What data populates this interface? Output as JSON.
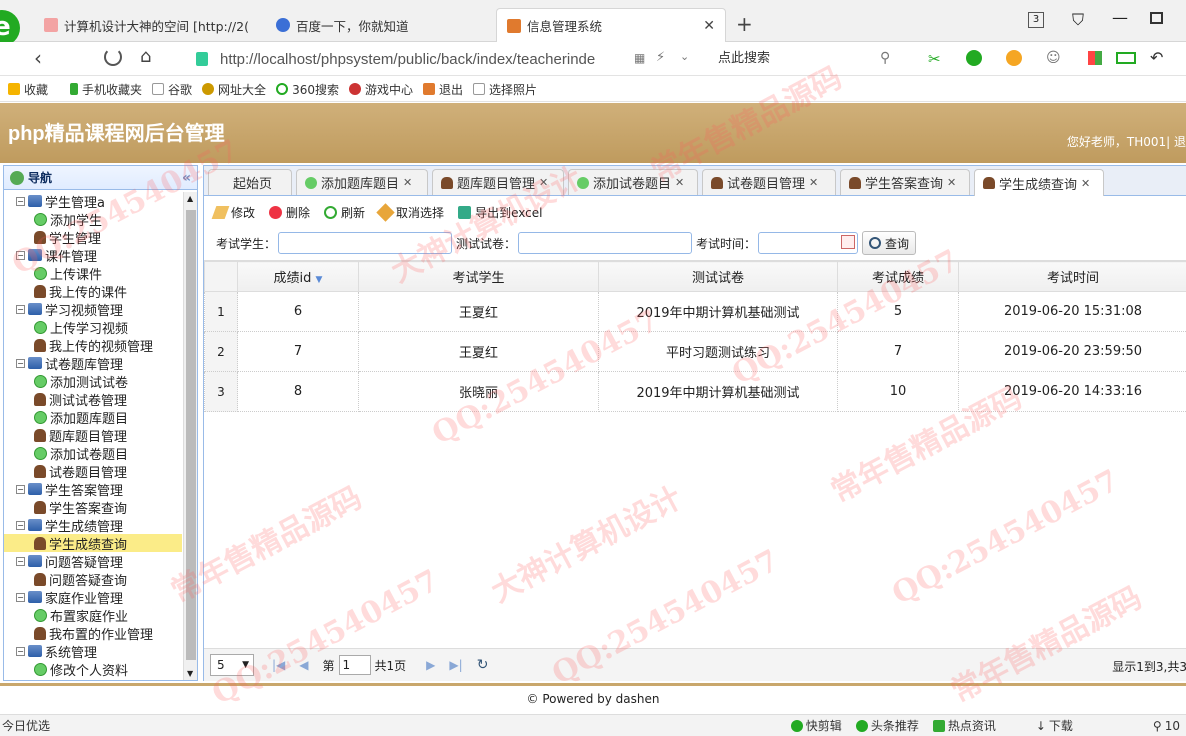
{
  "browser": {
    "tabs": [
      {
        "label": "计算机设计大神的空间 [http://2(",
        "active": false
      },
      {
        "label": "百度一下，你就知道",
        "active": false
      },
      {
        "label": "信息管理系统",
        "active": true
      }
    ],
    "tab_count": "3",
    "url": "http://localhost/phpsystem/public/back/index/teacherinde",
    "search_placeholder": "点此搜索",
    "bookmarks": [
      "收藏",
      "手机收藏夹",
      "谷歌",
      "网址大全",
      "360搜索",
      "游戏中心",
      "退出",
      "选择照片"
    ]
  },
  "app": {
    "title": "php精品课程网后台管理",
    "welcome": "您好老师，TH001| 退"
  },
  "nav": {
    "title": "导航",
    "tree": [
      {
        "label": "学生管理a",
        "level": 0,
        "icon": "folder"
      },
      {
        "label": "添加学生",
        "level": 1,
        "icon": "add"
      },
      {
        "label": "学生管理",
        "level": 1,
        "icon": "user"
      },
      {
        "label": "课件管理",
        "level": 0,
        "icon": "folder"
      },
      {
        "label": "上传课件",
        "level": 1,
        "icon": "add"
      },
      {
        "label": "我上传的课件",
        "level": 1,
        "icon": "user"
      },
      {
        "label": "学习视频管理",
        "level": 0,
        "icon": "folder"
      },
      {
        "label": "上传学习视频",
        "level": 1,
        "icon": "add"
      },
      {
        "label": "我上传的视频管理",
        "level": 1,
        "icon": "user"
      },
      {
        "label": "试卷题库管理",
        "level": 0,
        "icon": "folder"
      },
      {
        "label": "添加测试试卷",
        "level": 1,
        "icon": "add"
      },
      {
        "label": "测试试卷管理",
        "level": 1,
        "icon": "user"
      },
      {
        "label": "添加题库题目",
        "level": 1,
        "icon": "add"
      },
      {
        "label": "题库题目管理",
        "level": 1,
        "icon": "user"
      },
      {
        "label": "添加试卷题目",
        "level": 1,
        "icon": "add"
      },
      {
        "label": "试卷题目管理",
        "level": 1,
        "icon": "user"
      },
      {
        "label": "学生答案管理",
        "level": 0,
        "icon": "folder"
      },
      {
        "label": "学生答案查询",
        "level": 1,
        "icon": "user"
      },
      {
        "label": "学生成绩管理",
        "level": 0,
        "icon": "folder"
      },
      {
        "label": "学生成绩查询",
        "level": 1,
        "icon": "user",
        "selected": true
      },
      {
        "label": "问题答疑管理",
        "level": 0,
        "icon": "folder"
      },
      {
        "label": "问题答疑查询",
        "level": 1,
        "icon": "user"
      },
      {
        "label": "家庭作业管理",
        "level": 0,
        "icon": "folder"
      },
      {
        "label": "布置家庭作业",
        "level": 1,
        "icon": "add"
      },
      {
        "label": "我布置的作业管理",
        "level": 1,
        "icon": "user"
      },
      {
        "label": "系统管理",
        "level": 0,
        "icon": "folder"
      },
      {
        "label": "修改个人资料",
        "level": 1,
        "icon": "edit"
      }
    ]
  },
  "panel_tabs": [
    {
      "label": "起始页",
      "closable": false
    },
    {
      "label": "添加题库题目",
      "closable": true
    },
    {
      "label": "题库题目管理",
      "closable": true
    },
    {
      "label": "添加试卷题目",
      "closable": true
    },
    {
      "label": "试卷题目管理",
      "closable": true
    },
    {
      "label": "学生答案查询",
      "closable": true
    },
    {
      "label": "学生成绩查询",
      "closable": true,
      "active": true
    }
  ],
  "toolbar": {
    "edit": "修改",
    "delete": "删除",
    "refresh": "刷新",
    "deselect": "取消选择",
    "export": "导出到excel"
  },
  "filter": {
    "student_label": "考试学生：",
    "paper_label": "测试试卷：",
    "time_label": "考试时间：",
    "query": "查询"
  },
  "grid": {
    "columns": [
      "成绩id",
      "考试学生",
      "测试试卷",
      "考试成绩",
      "考试时间"
    ],
    "rows": [
      {
        "n": "1",
        "id": "6",
        "student": "王夏红",
        "paper": "2019年中期计算机基础测试",
        "score": "5",
        "time": "2019-06-20 15:31:08"
      },
      {
        "n": "2",
        "id": "7",
        "student": "王夏红",
        "paper": "平时习题测试练习",
        "score": "7",
        "time": "2019-06-20 23:59:50"
      },
      {
        "n": "3",
        "id": "8",
        "student": "张晓丽",
        "paper": "2019年中期计算机基础测试",
        "score": "10",
        "time": "2019-06-20 14:33:16"
      }
    ]
  },
  "pager": {
    "page_size": "5",
    "page_prefix": "第",
    "page": "1",
    "page_total": "共1页",
    "info": "显示1到3,共3"
  },
  "footer": "© Powered by dashen",
  "statusbar": {
    "left": "今日优选",
    "items": [
      "快剪辑",
      "头条推荐",
      "热点资讯",
      "下载"
    ],
    "zoom": "10"
  },
  "watermarks": [
    "QQ:254540457",
    "常年售精品源码",
    "大神计算机设计"
  ]
}
